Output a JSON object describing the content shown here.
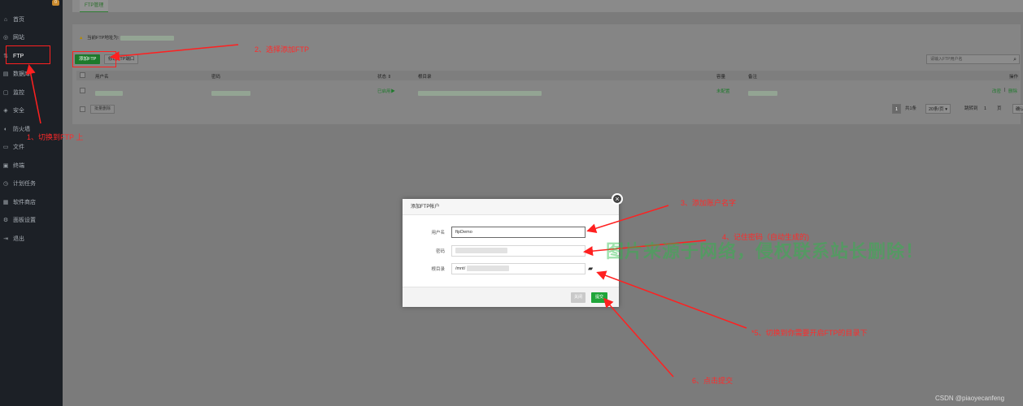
{
  "sidebar": {
    "badge": "0",
    "items": [
      {
        "label": "首页",
        "icon": "home-icon",
        "glyph": "⌂"
      },
      {
        "label": "网站",
        "icon": "globe-icon",
        "glyph": "◎"
      },
      {
        "label": "FTP",
        "icon": "ftp-icon",
        "glyph": "⇅"
      },
      {
        "label": "数据库",
        "icon": "database-icon",
        "glyph": "▤"
      },
      {
        "label": "监控",
        "icon": "monitor-icon",
        "glyph": "▢"
      },
      {
        "label": "安全",
        "icon": "shield-check-icon",
        "glyph": "◈"
      },
      {
        "label": "防火墙",
        "icon": "firewall-icon",
        "glyph": "◐"
      },
      {
        "label": "文件",
        "icon": "folder-icon",
        "glyph": "▭"
      },
      {
        "label": "终端",
        "icon": "terminal-icon",
        "glyph": "▣"
      },
      {
        "label": "计划任务",
        "icon": "clock-icon",
        "glyph": "◷"
      },
      {
        "label": "软件商店",
        "icon": "store-icon",
        "glyph": "▦"
      },
      {
        "label": "面板设置",
        "icon": "settings-icon",
        "glyph": "⚙"
      },
      {
        "label": "退出",
        "icon": "logout-icon",
        "glyph": "⇥"
      }
    ]
  },
  "tab": {
    "label": "FTP管理"
  },
  "ftp_page": {
    "address_label": "当前FTP地址为:",
    "add_button": "添加FTP",
    "port_button": "修改FTP端口",
    "search_placeholder": "请输入FTP用户名",
    "columns": {
      "username": "用户名",
      "password": "密码",
      "status": "状态",
      "root": "根目录",
      "capacity": "容量",
      "remark": "备注",
      "actions": "操作"
    },
    "row": {
      "status": "已启用",
      "capacity": "未配置",
      "edit": "改密",
      "delete": "删除"
    },
    "batch_delete": "批量删除",
    "pager": {
      "page": "1",
      "total": "共1条",
      "per_page": "20条/页",
      "jump_label": "跳转到",
      "jump_value": "1",
      "page_unit": "页",
      "confirm": "确认"
    }
  },
  "dialog": {
    "title": "添加FTP帐户",
    "username_label": "用户名",
    "username_value": "ftpDemo",
    "password_label": "密码",
    "root_label": "根目录",
    "root_value": "/mnt/",
    "close_button": "关闭",
    "submit_button": "提交"
  },
  "annotations": {
    "step1": "1、切换到FTP 上",
    "step2": "2、选择添加FTP",
    "step3": "3、添加账户名字",
    "step4": "4、记住密码（自动生成的)",
    "step5": "*5、切换到你需要开启FTP的目录下",
    "step6": "6、点击提交",
    "color": "#ff2a2a"
  },
  "watermark": "图片来源于网络，侵权联系站长删除！",
  "credit": "CSDN @piaoyecanfeng"
}
